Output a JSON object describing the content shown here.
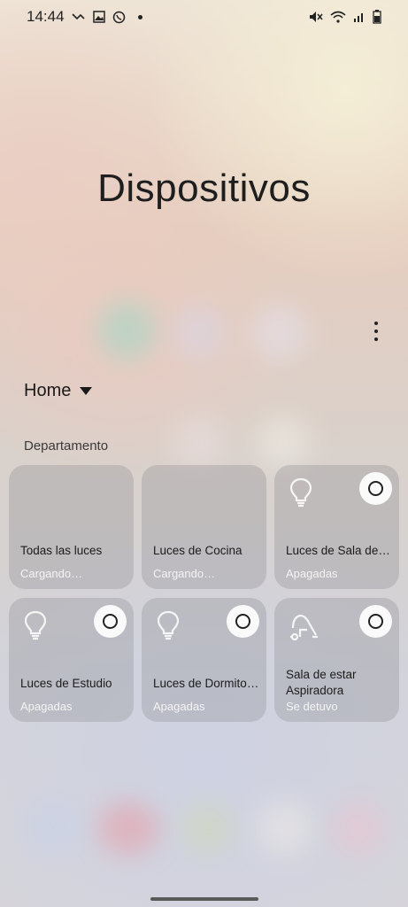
{
  "status_bar": {
    "time": "14:44",
    "left_icons": [
      "missed-call-icon",
      "image-icon",
      "whatsapp-icon",
      "dot-icon"
    ],
    "right_icons": [
      "mute-icon",
      "wifi-icon",
      "signal-icon",
      "battery-icon"
    ]
  },
  "page": {
    "title": "Dispositivos",
    "home_selector": "Home",
    "section_label": "Departamento"
  },
  "devices": [
    {
      "name": "Todas las luces",
      "status": "Cargando…",
      "icon": "",
      "toggle": false
    },
    {
      "name": "Luces de Cocina",
      "status": "Cargando…",
      "icon": "",
      "toggle": false
    },
    {
      "name": "Luces de Sala de …",
      "status": "Apagadas",
      "icon": "bulb-icon",
      "toggle": true
    },
    {
      "name": "Luces de Estudio",
      "status": "Apagadas",
      "icon": "bulb-icon",
      "toggle": true
    },
    {
      "name": "Luces de Dormitor…",
      "status": "Apagadas",
      "icon": "bulb-icon",
      "toggle": true
    },
    {
      "name": "Sala de estar\nAspiradora",
      "status": "Se detuvo",
      "icon": "vacuum-icon",
      "toggle": true
    }
  ]
}
